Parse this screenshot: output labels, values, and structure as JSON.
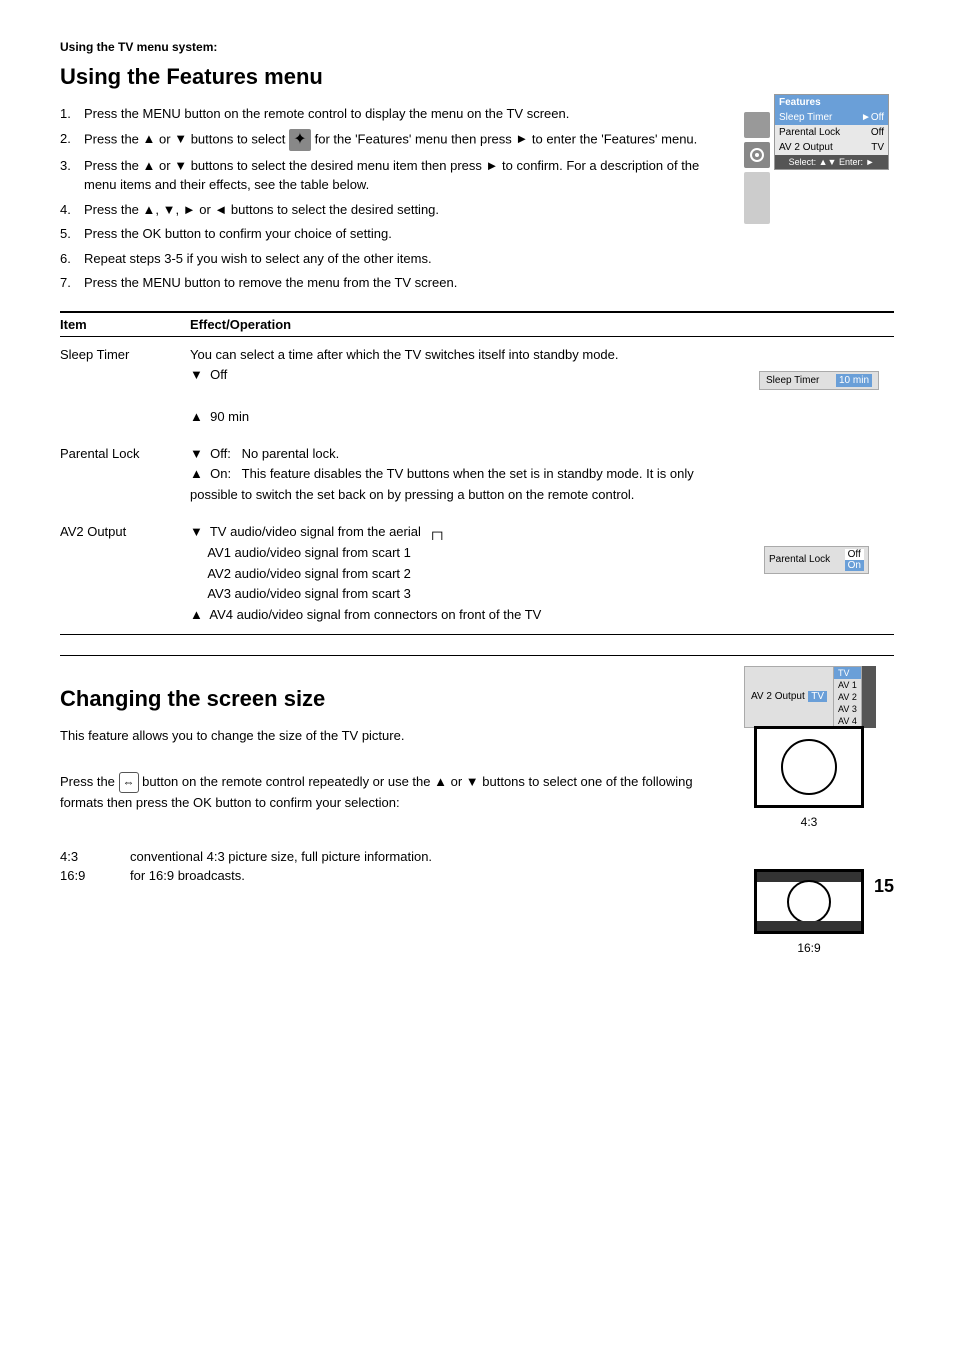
{
  "page": {
    "number": "15",
    "section_intro": "Using the TV menu system:",
    "features_heading": "Using the Features menu",
    "screen_size_heading": "Changing the screen size"
  },
  "numbered_steps": [
    "Press the MENU button on the remote control to display the menu on the TV screen.",
    "Press the ▲ or ▼ buttons to select  for the 'Features' menu then press ► to enter the 'Features' menu.",
    "Press the ▲ or ▼ buttons to select the desired menu item then press ► to confirm.  For a description of the menu items and their effects, see the table below.",
    "Press the ▲, ▼, ► or ◄ buttons to select the desired setting.",
    "Press the OK button to confirm your choice of setting.",
    "Repeat steps 3-5 if you wish to select any of the other items.",
    "Press the MENU button to remove the menu from the TV screen."
  ],
  "table": {
    "col1": "Item",
    "col2": "Effect/Operation",
    "rows": [
      {
        "item": "Sleep Timer",
        "effect": "You can select a time after which the TV switches itself into standby mode.",
        "down_label": "Off",
        "up_label": "90 min"
      },
      {
        "item": "Parental Lock",
        "effect_down": "Off:   No parental lock.",
        "effect_up": "On:   This feature disables the TV buttons when the set is in standby mode. It is only possible to switch the set back on by pressing a button on the remote control."
      },
      {
        "item": "AV2 Output",
        "lines": [
          "TV audio/video signal from the aerial  ┐",
          "AV1 audio/video signal from scart 1",
          "AV2 audio/video signal from scart 2",
          "AV3 audio/video signal from scart 3",
          "AV4 audio/video signal from connectors on front of the TV"
        ],
        "down_label": "TV",
        "up_label": "AV4"
      }
    ]
  },
  "features_menu": {
    "title": "Features",
    "items": [
      {
        "label": "Sleep Timer",
        "value": "Off",
        "selected": true,
        "has_arrow": true
      },
      {
        "label": "Parental Lock",
        "value": "Off"
      },
      {
        "label": "AV 2 Output",
        "value": "TV"
      }
    ],
    "footer": "Select: ▲▼ Enter: ►"
  },
  "sleep_timer_menu": {
    "label": "Sleep Timer",
    "value": "10 min"
  },
  "parental_lock_menu": {
    "label": "Parental Lock",
    "value_off": "Off",
    "value_on": "On"
  },
  "av_output_menu": {
    "label": "AV 2 Output",
    "value": "TV",
    "options": [
      "TV",
      "AV 1",
      "AV 2",
      "AV 3",
      "AV 4"
    ]
  },
  "screen_size": {
    "intro": "This feature allows you to change the size of the TV picture.",
    "body": "Press the  button on the remote control repeatedly or use the ▲ or ▼ buttons to select one of the following formats then press the OK button to confirm your selection:",
    "formats": [
      {
        "code": "4:3",
        "desc": "conventional 4:3 picture size, full picture information."
      },
      {
        "code": "16:9",
        "desc": "for 16:9 broadcasts."
      }
    ],
    "diagram_43_label": "4:3",
    "diagram_169_label": "16:9"
  }
}
